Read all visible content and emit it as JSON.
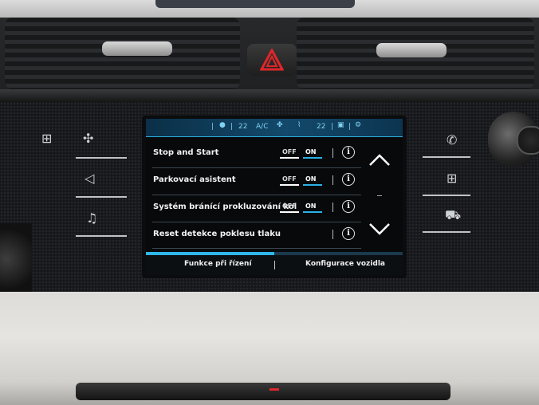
{
  "status_bar": {
    "separator": "|",
    "temp_left": "22",
    "ac_label": "A/C",
    "temp_right": "22",
    "icons": [
      "media-circle-icon",
      "fan-icon",
      "seat-airflow-icon",
      "rear-defrost-icon",
      "settings-gear-icon"
    ]
  },
  "settings": [
    {
      "label": "Stop and Start",
      "has_toggle": true,
      "off": "OFF",
      "on": "ON",
      "state": "ON"
    },
    {
      "label": "Parkovací asistent",
      "has_toggle": true,
      "off": "OFF",
      "on": "ON",
      "state": "ON"
    },
    {
      "label": "Systém bránící prokluzování kol",
      "has_toggle": true,
      "off": "OFF",
      "on": "ON",
      "state": "ON"
    },
    {
      "label": "Reset detekce poklesu tlaku",
      "has_toggle": false
    }
  ],
  "info_glyph": "i",
  "nav": {
    "up": "chevron-up-icon",
    "down": "chevron-down-icon"
  },
  "list_progress": 0.5,
  "tabs": [
    {
      "label": "Funkce při řízení",
      "active": true
    },
    {
      "label": "Konfigurace vozidla",
      "active": false
    }
  ],
  "colors": {
    "accent": "#2bb1e6",
    "status_bar": "#13496b",
    "hazard": "#e0262a"
  }
}
